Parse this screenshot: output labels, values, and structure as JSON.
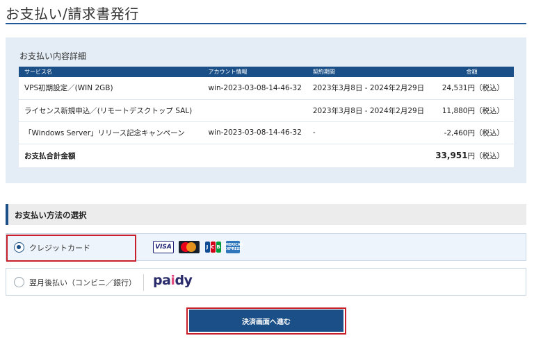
{
  "page": {
    "title": "お支払い/請求書発行"
  },
  "details": {
    "heading": "お支払い内容詳細",
    "columns": {
      "service": "サービス名",
      "account": "アカウント情報",
      "period": "契約期間",
      "amount": "金額"
    },
    "rows": [
      {
        "service": "VPS初期設定／(WIN 2GB)",
        "account": "win-2023-03-08-14-46-32",
        "period": "2023年3月8日 - 2024年2月29日",
        "amount": "24,531円（税込）"
      },
      {
        "service": "ライセンス新規申込／(リモートデスクトップ SAL)",
        "account": "",
        "period": "2023年3月8日 - 2024年2月29日",
        "amount": "11,880円（税込）"
      },
      {
        "service": "「Windows Server」リリース記念キャンペーン",
        "account": "win-2023-03-08-14-46-32",
        "period": "-",
        "amount": "-2,460円（税込）"
      }
    ],
    "total": {
      "label": "お支払合計金額",
      "value": "33,951",
      "suffix": "円（税込）"
    }
  },
  "payment": {
    "heading": "お支払い方法の選択",
    "options": [
      {
        "label": "クレジットカード",
        "selected": true
      },
      {
        "label": "翌月後払い（コンビニ／銀行）",
        "selected": false
      }
    ],
    "card_logos": {
      "visa": "VISA",
      "jcb": [
        "J",
        "C",
        "B"
      ],
      "amex": [
        "AMERICAN",
        "EXPRESS"
      ]
    },
    "paidy_logo": {
      "pa": "pa",
      "i": "i",
      "dy": "dy"
    }
  },
  "submit": {
    "label": "決済画面へ進む"
  },
  "colors": {
    "primary": "#1b4f87",
    "highlight": "#c8202b",
    "panel": "#e4edf6"
  }
}
